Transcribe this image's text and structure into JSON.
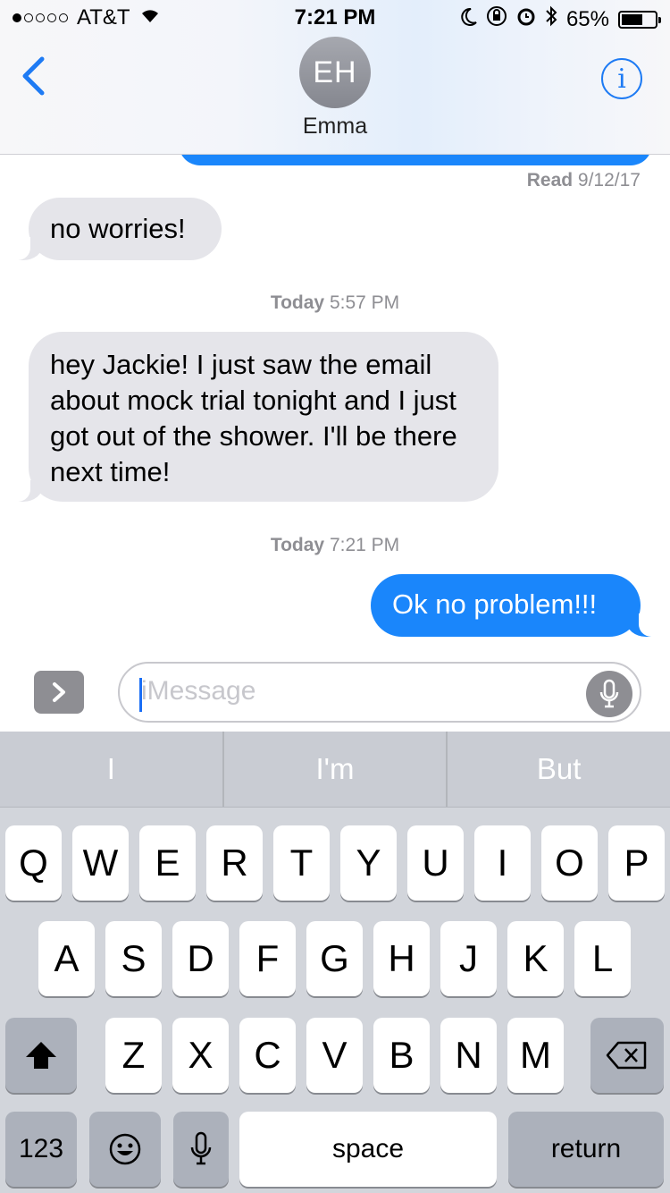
{
  "status_bar": {
    "carrier": "AT&T",
    "time": "7:21 PM",
    "battery": "65%",
    "battery_level": 0.65,
    "signal_bars": 1
  },
  "nav": {
    "avatar_initials": "EH",
    "contact_name": "Emma"
  },
  "conversation": {
    "read_label": "Read",
    "read_date": "9/12/17",
    "messages": [
      {
        "direction": "incoming",
        "text": "no worries!"
      },
      {
        "stamp_day": "Today",
        "stamp_time": "5:57 PM"
      },
      {
        "direction": "incoming",
        "text": "hey Jackie! I just saw the email about mock trial tonight and I just got out of the shower. I'll be there next time!"
      },
      {
        "stamp_day": "Today",
        "stamp_time": "7:21 PM"
      },
      {
        "direction": "outgoing",
        "text": "Ok no problem!!!"
      }
    ]
  },
  "composer": {
    "placeholder": "iMessage"
  },
  "keyboard": {
    "suggestions": [
      "I",
      "I'm",
      "But"
    ],
    "row1": [
      "Q",
      "W",
      "E",
      "R",
      "T",
      "Y",
      "U",
      "I",
      "O",
      "P"
    ],
    "row2": [
      "A",
      "S",
      "D",
      "F",
      "G",
      "H",
      "J",
      "K",
      "L"
    ],
    "row3": [
      "Z",
      "X",
      "C",
      "V",
      "B",
      "N",
      "M"
    ],
    "numbers_label": "123",
    "space_label": "space",
    "return_label": "return"
  },
  "colors": {
    "accent_blue": "#1a86fb",
    "incoming_bubble": "#e5e5ea",
    "keyboard_bg": "#d2d5db"
  },
  "icons": [
    "wifi-icon",
    "moon-icon",
    "rotation-lock-icon",
    "alarm-icon",
    "bluetooth-icon",
    "battery-icon",
    "back-chevron-icon",
    "info-icon",
    "apps-chevron-icon",
    "dictation-mic-icon",
    "shift-icon",
    "delete-icon",
    "emoji-icon",
    "keyboard-mic-icon"
  ]
}
